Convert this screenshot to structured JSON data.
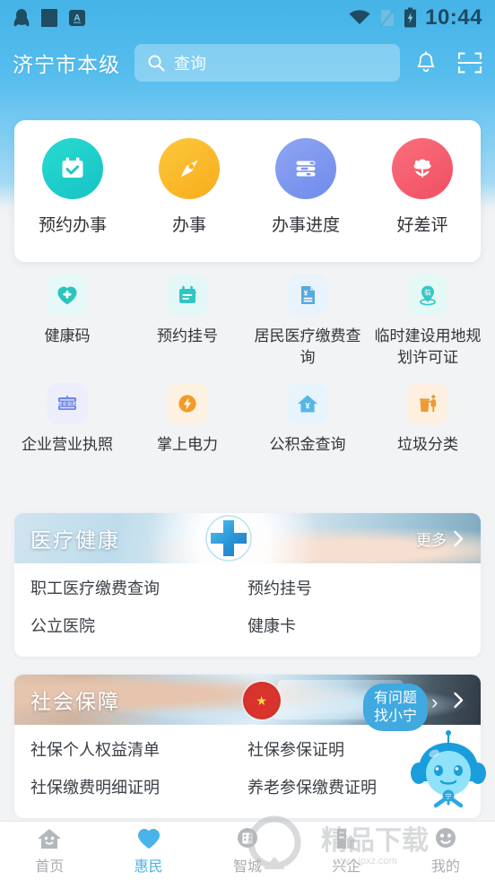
{
  "statusbar": {
    "icons_left": [
      "qq-icon",
      "app-square-icon",
      "a-badge-icon"
    ],
    "icons_right": [
      "wifi-icon",
      "sim-off-icon",
      "battery-charging-icon"
    ],
    "time": "10:44"
  },
  "header": {
    "city": "济宁市本级",
    "search_placeholder": "查询",
    "search_value": "",
    "icons": [
      "search-icon",
      "bell-icon",
      "scan-icon"
    ]
  },
  "quick_actions": [
    {
      "label": "预约办事",
      "icon": "calendar-check-icon",
      "color": "#1fd1c8"
    },
    {
      "label": "办事",
      "icon": "compass-icon",
      "color": "#fbbe2c"
    },
    {
      "label": "办事进度",
      "icon": "progress-bars-icon",
      "color": "#7b96ee"
    },
    {
      "label": "好差评",
      "icon": "flower-icon",
      "color": "#f5606e"
    }
  ],
  "grid": [
    [
      {
        "label": "健康码",
        "icon": "heart-plus-icon",
        "color": "#2bc4c0",
        "bg": "#e6f8f7"
      },
      {
        "label": "预约挂号",
        "icon": "calendar-plus-icon",
        "color": "#31c6c3",
        "bg": "#e3f7f6"
      },
      {
        "label": "居民医疗缴费查询",
        "icon": "bill-yuan-icon",
        "color": "#56a8e0",
        "bg": "#e8f3fb"
      },
      {
        "label": "临时建设用地规划许可证",
        "icon": "location-pin-lin-icon",
        "color": "#35c8c3",
        "bg": "#e4f8f6"
      }
    ],
    [
      {
        "label": "企业营业执照",
        "icon": "business-license-icon",
        "color": "#6e86e8",
        "bg": "#eceefc"
      },
      {
        "label": "掌上电力",
        "icon": "lightning-icon",
        "color": "#f29b28",
        "bg": "#fdf1e2"
      },
      {
        "label": "公积金查询",
        "icon": "house-yuan-icon",
        "color": "#57b6e6",
        "bg": "#e7f4fc"
      },
      {
        "label": "垃圾分类",
        "icon": "trash-sort-icon",
        "color": "#ef9a33",
        "bg": "#fdf0e0"
      }
    ]
  ],
  "sections": [
    {
      "title": "医疗健康",
      "more_label": "更多",
      "banner_icon": "medical-cross-icon",
      "links": [
        [
          "职工医疗缴费查询",
          "预约挂号"
        ],
        [
          "公立医院",
          "健康卡"
        ]
      ]
    },
    {
      "title": "社会保障",
      "more_label": "",
      "banner_icon": "social-card-icon",
      "links": [
        [
          "社保个人权益清单",
          "社保参保证明"
        ],
        [
          "社保缴费明细证明",
          "养老参保缴费证明"
        ]
      ]
    }
  ],
  "assistant": {
    "bubble_line1": "有问题",
    "bubble_line2": "找小宁",
    "mascot_name": "宁",
    "icon": "robot-assistant-icon"
  },
  "tabbar": {
    "items": [
      {
        "label": "首页",
        "icon": "home-icon",
        "active": false
      },
      {
        "label": "惠民",
        "icon": "heart-icon",
        "active": true
      },
      {
        "label": "智城",
        "icon": "city-icon",
        "active": false
      },
      {
        "label": "兴企",
        "icon": "building-icon",
        "active": false
      },
      {
        "label": "我的",
        "icon": "profile-icon",
        "active": false
      }
    ]
  },
  "theme": {
    "accent": "#4ab3ea",
    "header_gradient_top": "#45b3e6",
    "header_gradient_bottom": "#a9dcf5",
    "page_bg": "#f2f3f5",
    "card_bg": "#ffffff",
    "text_primary": "#303438",
    "text_muted": "#a9adb2"
  },
  "watermark": {
    "text": "精品下载",
    "sub": "www.jpxz.com"
  }
}
